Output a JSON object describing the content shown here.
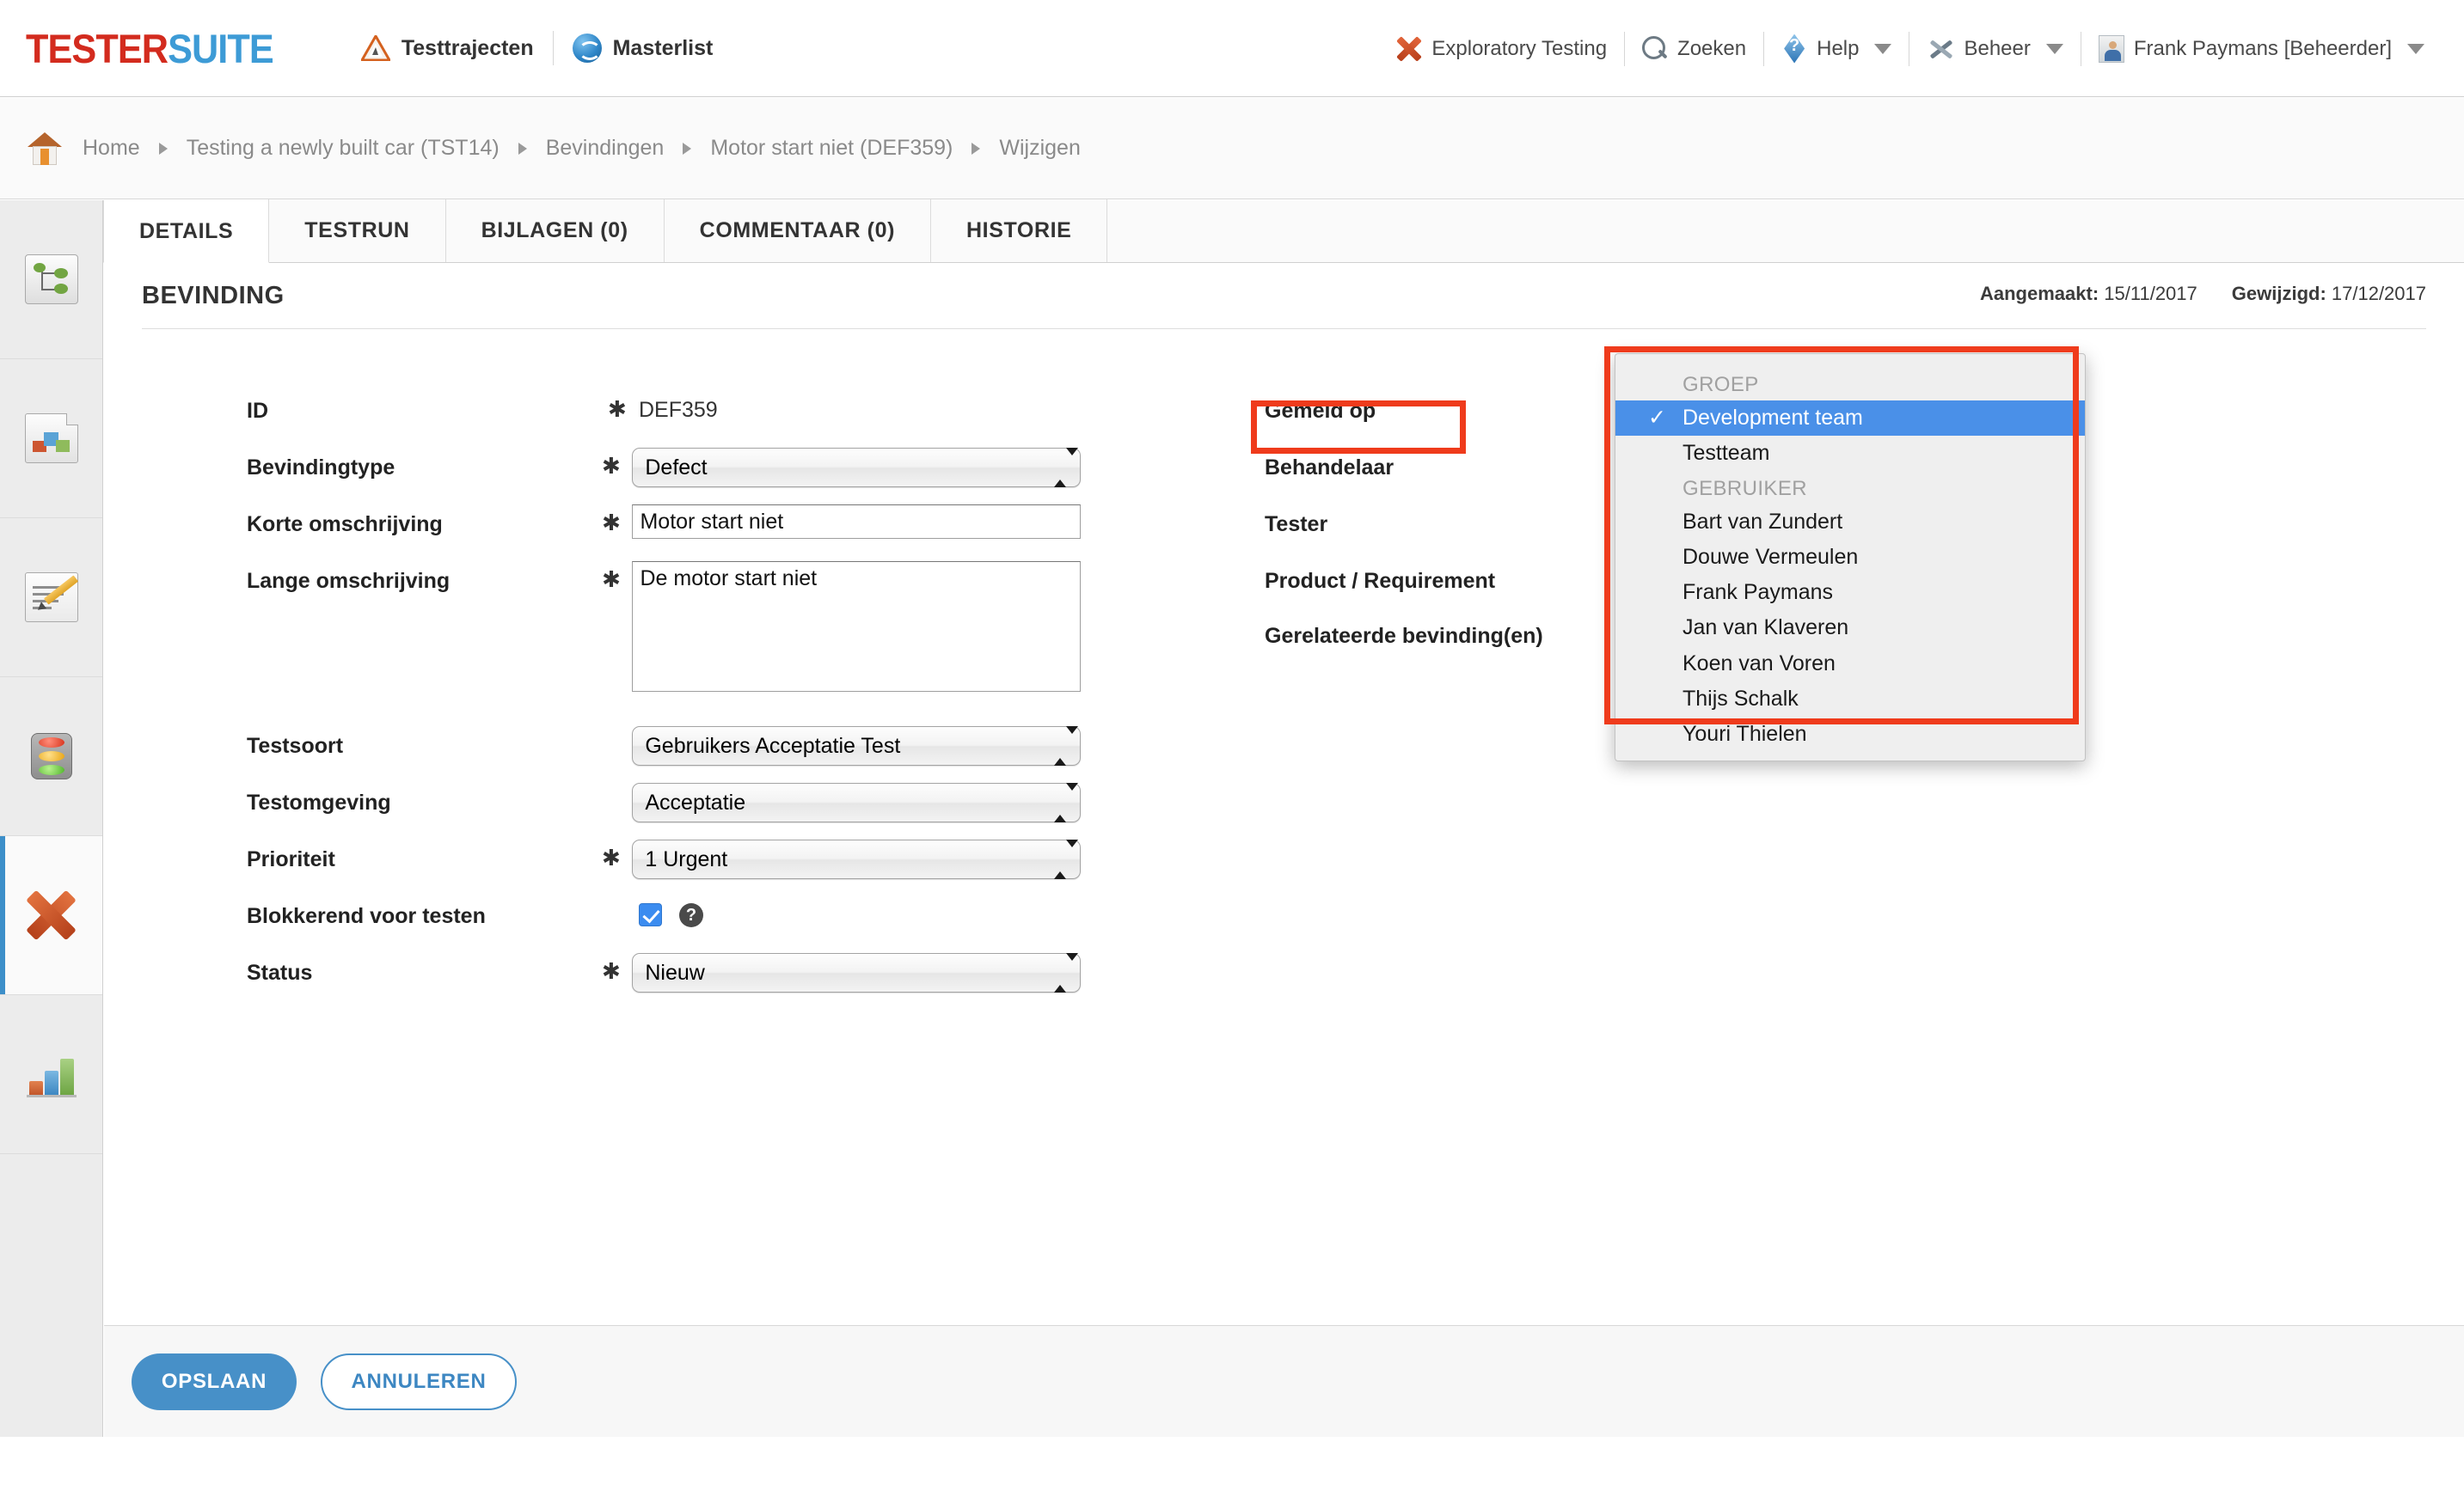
{
  "brand": {
    "part1": "TESTER",
    "part2": "SUITE",
    "color1": "#d32b1e",
    "color2": "#3d9bd6"
  },
  "topnav": [
    {
      "label": "Testtrajecten",
      "icon": "warning-triangle-icon"
    },
    {
      "label": "Masterlist",
      "icon": "globe-refresh-icon"
    }
  ],
  "topright": [
    {
      "label": "Exploratory Testing",
      "icon": "red-x-icon",
      "caret": false
    },
    {
      "label": "Zoeken",
      "icon": "search-icon",
      "caret": false
    },
    {
      "label": "Help",
      "icon": "help-diamond-icon",
      "caret": true
    },
    {
      "label": "Beheer",
      "icon": "tools-icon",
      "caret": true
    },
    {
      "label": "Frank Paymans [Beheerder]",
      "icon": "avatar-icon",
      "caret": true
    }
  ],
  "breadcrumb": {
    "home_icon": "home-icon",
    "items": [
      "Home",
      "Testing a newly built car (TST14)",
      "Bevindingen",
      "Motor start niet (DEF359)",
      "Wijzigen"
    ]
  },
  "sidebar": {
    "items": [
      {
        "name": "tree",
        "icon": "tree-structure-icon",
        "active": false
      },
      {
        "name": "documents",
        "icon": "document-blocks-icon",
        "active": false
      },
      {
        "name": "testcases",
        "icon": "document-edit-icon",
        "active": false
      },
      {
        "name": "status",
        "icon": "traffic-light-icon",
        "active": false
      },
      {
        "name": "defects",
        "icon": "orange-x-icon",
        "active": true
      },
      {
        "name": "reports",
        "icon": "bar-chart-icon",
        "active": false
      }
    ]
  },
  "tabs": [
    {
      "label": "DETAILS",
      "active": true
    },
    {
      "label": "TESTRUN",
      "active": false
    },
    {
      "label": "BIJLAGEN (0)",
      "active": false
    },
    {
      "label": "COMMENTAAR (0)",
      "active": false
    },
    {
      "label": "HISTORIE",
      "active": false
    }
  ],
  "panel": {
    "title": "BEVINDING",
    "created_label": "Aangemaakt:",
    "created_value": "15/11/2017",
    "modified_label": "Gewijzigd:",
    "modified_value": "17/12/2017"
  },
  "form_left": {
    "id": {
      "label": "ID",
      "required": "✱",
      "value": "DEF359"
    },
    "bevindingtype": {
      "label": "Bevindingtype",
      "required": "✱",
      "value": "Defect"
    },
    "korte": {
      "label": "Korte omschrijving",
      "required": "✱",
      "value": "Motor start niet"
    },
    "lange": {
      "label": "Lange omschrijving",
      "required": "✱",
      "value": "De motor start niet"
    },
    "testsoort": {
      "label": "Testsoort",
      "required": "",
      "value": "Gebruikers Acceptatie Test"
    },
    "testomgeving": {
      "label": "Testomgeving",
      "required": "",
      "value": "Acceptatie"
    },
    "prioriteit": {
      "label": "Prioriteit",
      "required": "✱",
      "value": "1 Urgent"
    },
    "blokkerend": {
      "label": "Blokkerend voor testen",
      "checked": true,
      "help": "?"
    },
    "status": {
      "label": "Status",
      "required": "✱",
      "value": "Nieuw"
    }
  },
  "form_right": {
    "gemeld_op": {
      "label": "Gemeld op",
      "required": "✱"
    },
    "behandelaar": {
      "label": "Behandelaar",
      "required": "",
      "highlighted": true
    },
    "tester": {
      "label": "Tester",
      "required": "✱"
    },
    "product": {
      "label": "Product / Requirement",
      "required": ""
    },
    "gerelateerde": {
      "label": "Gerelateerde bevinding(en)",
      "required": ""
    }
  },
  "dropdown": {
    "groups": [
      {
        "header": "GROEP",
        "options": [
          {
            "label": "Development team",
            "selected": true,
            "check": "✓"
          },
          {
            "label": "Testteam",
            "selected": false,
            "check": ""
          }
        ]
      },
      {
        "header": "GEBRUIKER",
        "options": [
          {
            "label": "Bart van Zundert",
            "selected": false,
            "check": ""
          },
          {
            "label": "Douwe Vermeulen",
            "selected": false,
            "check": ""
          },
          {
            "label": "Frank Paymans",
            "selected": false,
            "check": ""
          },
          {
            "label": "Jan van Klaveren",
            "selected": false,
            "check": ""
          },
          {
            "label": "Koen van Voren",
            "selected": false,
            "check": ""
          },
          {
            "label": "Thijs Schalk",
            "selected": false,
            "check": ""
          },
          {
            "label": "Youri Thielen",
            "selected": false,
            "check": ""
          }
        ]
      }
    ],
    "highlight_color": "#ef3b1c",
    "selected_color": "#4a90e8"
  },
  "footer": {
    "save_label": "OPSLAAN",
    "cancel_label": "ANNULEREN",
    "primary_color": "#4790c8"
  }
}
